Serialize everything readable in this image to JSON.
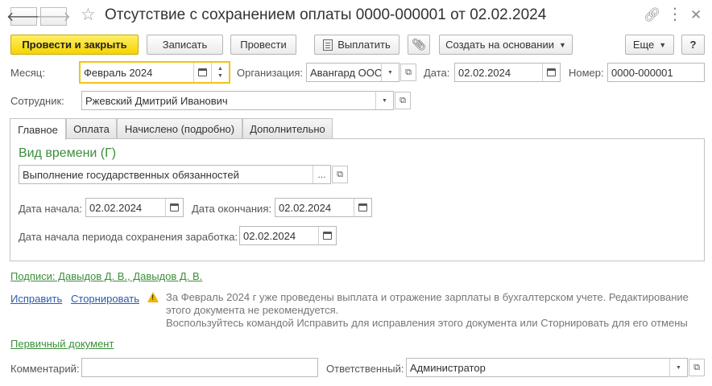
{
  "window": {
    "title": "Отсутствие с сохранением оплаты 0000-000001 от 02.02.2024"
  },
  "toolbar": {
    "post_close": "Провести и закрыть",
    "save": "Записать",
    "post": "Провести",
    "pay": "Выплатить",
    "create_based": "Создать на основании",
    "more": "Еще",
    "help": "?"
  },
  "header": {
    "month_label": "Месяц:",
    "month_value": "Февраль 2024",
    "org_label": "Организация:",
    "org_value": "Авангард ООО",
    "date_label": "Дата:",
    "date_value": "02.02.2024",
    "number_label": "Номер:",
    "number_value": "0000-000001",
    "employee_label": "Сотрудник:",
    "employee_value": "Ржевский Дмитрий Иванович"
  },
  "tabs": [
    {
      "label": "Главное"
    },
    {
      "label": "Оплата"
    },
    {
      "label": "Начислено (подробно)"
    },
    {
      "label": "Дополнительно"
    }
  ],
  "main": {
    "time_type_title": "Вид времени (Г)",
    "time_type_value": "Выполнение государственных обязанностей",
    "start_label": "Дата начала:",
    "start_value": "02.02.2024",
    "end_label": "Дата окончания:",
    "end_value": "02.02.2024",
    "period_label": "Дата начала периода сохранения заработка:",
    "period_value": "02.02.2024"
  },
  "footer": {
    "signatures": "Подписи: Давыдов Д. В., Давыдов Д. В.",
    "fix": "Исправить",
    "reverse": "Сторнировать",
    "warning_line1": "За Февраль 2024 г уже проведены выплата и отражение зарплаты в бухгалтерском учете. Редактирование",
    "warning_line2": "этого документа не рекомендуется.",
    "warning_line3": "Воспользуйтесь командой Исправить для исправления этого документа или Сторнировать для его отмены",
    "primary_doc": "Первичный документ",
    "comment_label": "Комментарий:",
    "comment_value": "",
    "responsible_label": "Ответственный:",
    "responsible_value": "Администратор"
  }
}
